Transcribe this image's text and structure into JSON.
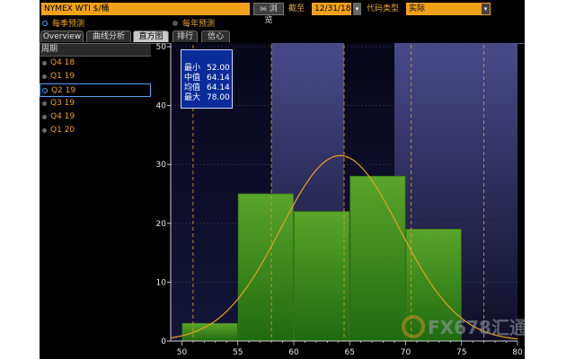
{
  "toolbar": {
    "security": "NYMEX WTI $/桶",
    "browse_icon": "96",
    "browse_label": "浏览",
    "asof_label": "截至",
    "date": "12/31/18",
    "code_type_label": "代码类型",
    "code_type_value": "实际"
  },
  "radios": {
    "quarterly": "每季预测",
    "yearly": "每年预测",
    "selected": "quarterly"
  },
  "tabs": [
    {
      "label": "Overview",
      "active": false
    },
    {
      "label": "曲线分析",
      "active": false
    },
    {
      "label": "直方图",
      "active": true
    },
    {
      "label": "排行",
      "active": false
    },
    {
      "label": "信心",
      "active": false
    }
  ],
  "left_panel": {
    "header": "周期",
    "periods": [
      {
        "label": "Q4 18",
        "selected": false
      },
      {
        "label": "Q1 19",
        "selected": false
      },
      {
        "label": "Q2 19",
        "selected": true
      },
      {
        "label": "Q3 19",
        "selected": false
      },
      {
        "label": "Q4 19",
        "selected": false
      },
      {
        "label": "Q1 20",
        "selected": false
      }
    ]
  },
  "stats": {
    "min_label": "最小",
    "min": "52.00",
    "median_label": "中值",
    "median": "64.14",
    "mean_label": "均值",
    "mean": "64.14",
    "max_label": "最大",
    "max": "78.00"
  },
  "watermark": "FX678汇通网",
  "colors": {
    "bar_fill": "#5aa52a",
    "curve": "#e8a020",
    "shade": "#4a4a8c",
    "field": "#f2a21a",
    "accent": "#4aa3ff"
  },
  "chart_data": {
    "type": "bar",
    "bins": [
      {
        "start": 50,
        "end": 55,
        "value": 3
      },
      {
        "start": 55,
        "end": 60,
        "value": 25
      },
      {
        "start": 60,
        "end": 65,
        "value": 22
      },
      {
        "start": 65,
        "end": 70,
        "value": 28
      },
      {
        "start": 70,
        "end": 75,
        "value": 19
      }
    ],
    "xlim": [
      49,
      80
    ],
    "ylim": [
      0,
      50
    ],
    "xticks": [
      50,
      55,
      60,
      65,
      70,
      75,
      80
    ],
    "yticks": [
      0,
      10,
      20,
      30,
      40,
      50
    ],
    "shaded_ranges": [
      [
        58,
        64.5
      ],
      [
        69,
        80
      ]
    ],
    "vlines": [
      51,
      58,
      64.5,
      70.5,
      77
    ],
    "normal_curve": {
      "mean": 64.14,
      "sd": 5.3,
      "peak": 31.5
    },
    "title": "",
    "xlabel": "",
    "ylabel": ""
  }
}
